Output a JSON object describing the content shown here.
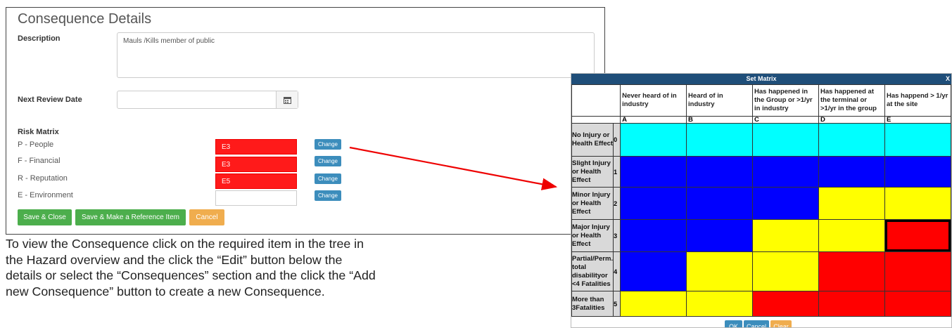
{
  "form": {
    "title": "Consequence Details",
    "description_label": "Description",
    "description_value": "Mauls /Kills member of public",
    "review_label": "Next Review Date",
    "review_value": "",
    "risk_matrix_label": "Risk Matrix",
    "rows": [
      {
        "label": "P - People",
        "value": "E3",
        "change": "Change"
      },
      {
        "label": "F - Financial",
        "value": "E3",
        "change": "Change"
      },
      {
        "label": "R - Reputation",
        "value": "E5",
        "change": "Change"
      },
      {
        "label": "E - Environment",
        "value": "",
        "change": "Change"
      }
    ],
    "buttons": {
      "save_close": "Save & Close",
      "save_reference": "Save & Make a Reference Item",
      "cancel": "Cancel"
    }
  },
  "body_text": [
    "To view the Consequence click on the required item in the tree in",
    "the Hazard overview and the click the “Edit” button below the",
    "details or select the “Consequences” section and the click the “Add",
    "new Consequence” button to create a new Consequence."
  ],
  "matrix": {
    "title": "Set Matrix",
    "close": "X",
    "columns": [
      {
        "header": "Never heard of in industry",
        "letter": "A"
      },
      {
        "header": "Heard of in industry",
        "letter": "B"
      },
      {
        "header": "Has happened in the Group or >1/yr in industry",
        "letter": "C"
      },
      {
        "header": "Has happened at the terminal or >1/yr in the group",
        "letter": "D"
      },
      {
        "header": "Has happend > 1/yr at the site",
        "letter": "E"
      }
    ],
    "rows": [
      {
        "label": "No Injury or Health Effect",
        "num": "0",
        "cells": [
          "cyan",
          "cyan",
          "cyan",
          "cyan",
          "cyan"
        ]
      },
      {
        "label": "Slight Injury or Health Effect",
        "num": "1",
        "cells": [
          "blue",
          "blue",
          "blue",
          "blue",
          "blue"
        ]
      },
      {
        "label": "Minor Injury or Health Effect",
        "num": "2",
        "cells": [
          "blue",
          "blue",
          "blue",
          "yellow",
          "yellow"
        ]
      },
      {
        "label": "Major Injury or Health Effect",
        "num": "3",
        "cells": [
          "blue",
          "blue",
          "yellow",
          "yellow",
          "red"
        ]
      },
      {
        "label": "Partial/Perm. total disabilityor <4 Fatalities",
        "num": "4",
        "cells": [
          "blue",
          "yellow",
          "yellow",
          "red",
          "red"
        ]
      },
      {
        "label": "More than 3Fatalities",
        "num": "5",
        "cells": [
          "yellow",
          "yellow",
          "red",
          "red",
          "red"
        ]
      }
    ],
    "selected_cell": {
      "row": "3",
      "column": "E"
    },
    "colors": {
      "cyan": "#00ffff",
      "blue": "#0000ff",
      "yellow": "#ffff00",
      "red": "#ff0000"
    },
    "buttons": {
      "ok": "OK",
      "cancel": "Cancel",
      "clear": "Clear"
    }
  }
}
